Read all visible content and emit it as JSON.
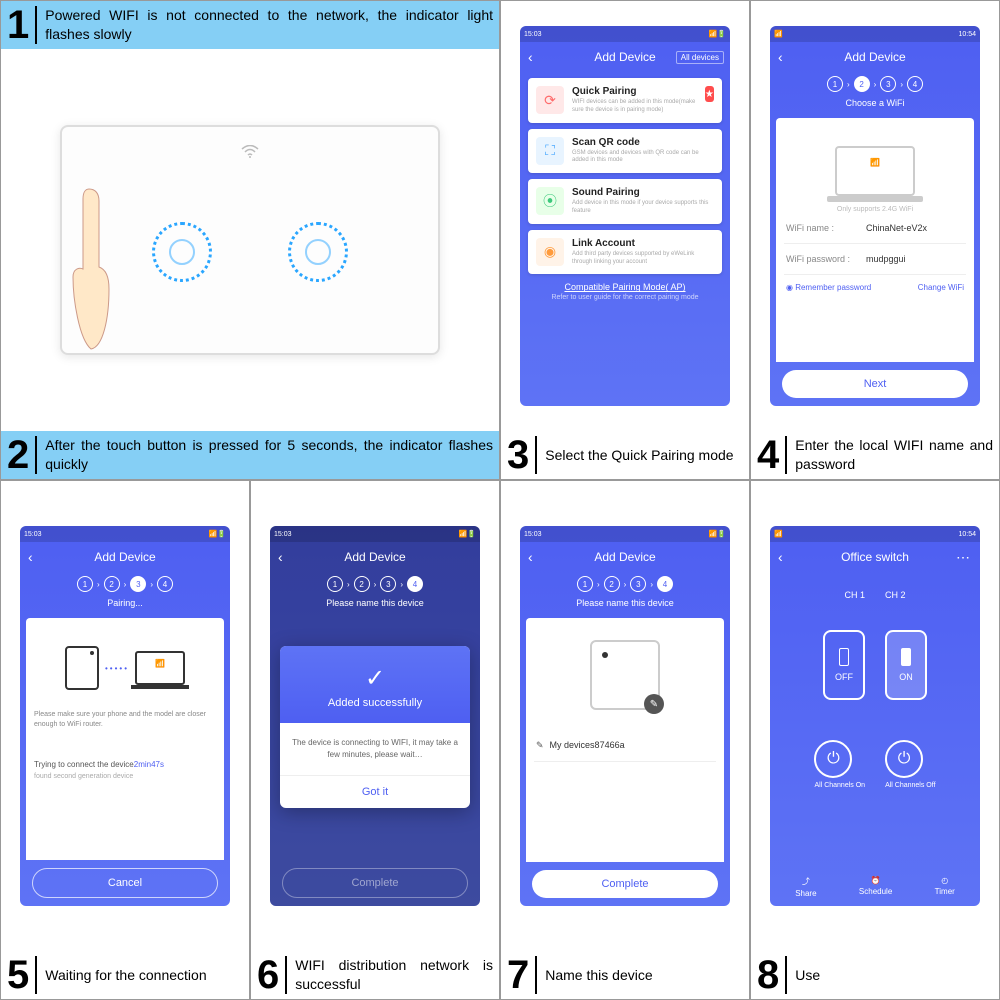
{
  "steps": {
    "s1": {
      "num": "1",
      "text": "Powered WIFI is not connected to the network, the indicator light flashes slowly"
    },
    "s2": {
      "num": "2",
      "text": "After the touch button is pressed for 5 seconds, the indicator flashes quickly"
    },
    "s3": {
      "num": "3",
      "text": "Select the Quick Pairing mode"
    },
    "s4": {
      "num": "4",
      "text": "Enter the local WIFI name and password"
    },
    "s5": {
      "num": "5",
      "text": "Waiting for the connection"
    },
    "s6": {
      "num": "6",
      "text": "WIFI distribution network is successful"
    },
    "s7": {
      "num": "7",
      "text": "Name this device"
    },
    "s8": {
      "num": "8",
      "text": "Use"
    }
  },
  "status_time_a": "15:03",
  "status_time_b": "10:54",
  "nav": {
    "add_device": "Add Device",
    "all_devices": "All devices",
    "office": "Office switch"
  },
  "pairing": {
    "quick": {
      "title": "Quick Pairing",
      "desc": "WIFI devices can be added in this mode(make sure the device is in pairing mode)"
    },
    "qr": {
      "title": "Scan QR code",
      "desc": "GSM devices and devices with QR code can be added in this mode"
    },
    "sound": {
      "title": "Sound Pairing",
      "desc": "Add device in this mode if your device supports this feature"
    },
    "link": {
      "title": "Link Account",
      "desc": "Add third party devices supported by eWeLink through linking your account"
    },
    "compat": "Compatible Pairing Mode( AP)",
    "hint": "Refer to user guide for the correct pairing mode"
  },
  "wifi": {
    "choose": "Choose a WiFi",
    "supports": "Only supports 2.4G WiFi",
    "name_lbl": "WiFi name :",
    "name_val": "ChinaNet-eV2x",
    "pwd_lbl": "WiFi password :",
    "pwd_val": "mudpggui",
    "remember": "Remember password",
    "change": "Change WiFi",
    "next": "Next"
  },
  "connect": {
    "pairing": "Pairing...",
    "close_hint": "Please make sure your phone and the model are closer enough to WiFi router.",
    "trying": "Trying to connect the device",
    "timer": "2min47s",
    "found": "found second generation device",
    "cancel": "Cancel"
  },
  "success": {
    "name_hint": "Please name this device",
    "added": "Added successfully",
    "connecting": "The device is connecting to WIFI, it may take a few minutes, please wait…",
    "gotit": "Got it",
    "complete": "Complete"
  },
  "naming": {
    "default": "My devices87466a"
  },
  "use": {
    "ch1": "CH 1",
    "ch2": "CH 2",
    "off": "OFF",
    "on": "ON",
    "all_on": "All Channels On",
    "all_off": "All Channels Off",
    "share": "Share",
    "schedule": "Schedule",
    "timer": "Timer"
  }
}
